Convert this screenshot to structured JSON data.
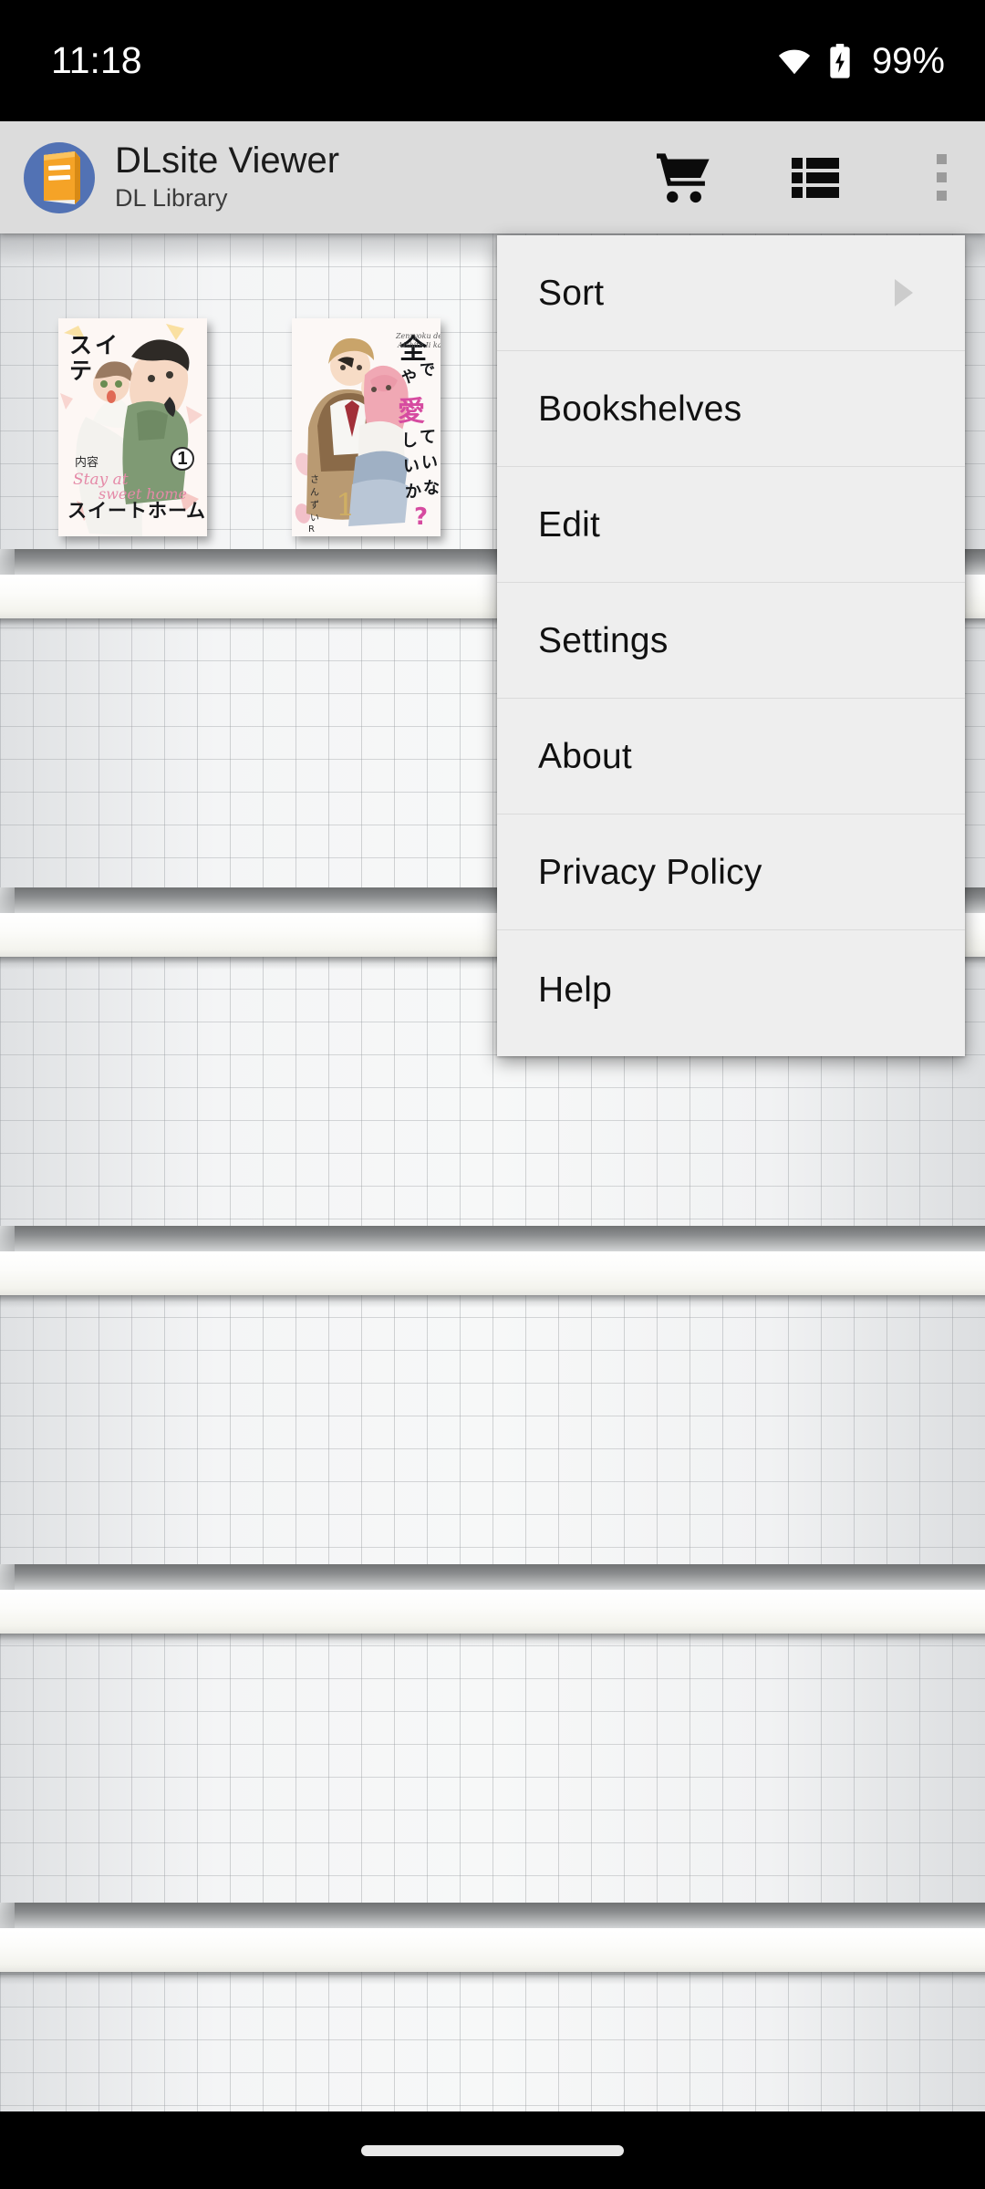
{
  "status_bar": {
    "clock": "11:18",
    "battery_percent": "99%",
    "icons": [
      "wifi-icon",
      "battery-charging-icon"
    ]
  },
  "app_bar": {
    "app_icon": "book-app-icon",
    "title": "DLsite Viewer",
    "subtitle": "DL Library",
    "actions": [
      {
        "name": "cart-icon",
        "label": "Cart"
      },
      {
        "name": "view-mode-icon",
        "label": "View mode"
      },
      {
        "name": "overflow-menu-icon",
        "label": "More options"
      }
    ]
  },
  "overflow_menu": {
    "items": [
      {
        "label": "Sort",
        "has_submenu": true
      },
      {
        "label": "Bookshelves",
        "has_submenu": false
      },
      {
        "label": "Edit",
        "has_submenu": false
      },
      {
        "label": "Settings",
        "has_submenu": false
      },
      {
        "label": "About",
        "has_submenu": false
      },
      {
        "label": "Privacy Policy",
        "has_submenu": false
      },
      {
        "label": "Help",
        "has_submenu": false
      }
    ]
  },
  "library": {
    "books": [
      {
        "title_lines": [
          "ステイ",
          "&",
          "スイートホーム"
        ],
        "romaji_title": "Stay at sweet home",
        "author": "内容",
        "volume_badge": "1"
      },
      {
        "title_lines": [
          "全力で",
          "愛して",
          "いいかな?"
        ],
        "author": "さんずい R",
        "volume_badge": "1"
      }
    ]
  },
  "nav_bar": {
    "gesture_pill": "home-gesture-pill"
  },
  "colors": {
    "status_bar_bg": "#000000",
    "app_bar_bg": "#dcdcdc",
    "menu_bg": "#eeeeee",
    "menu_divider": "#dadada",
    "accent_blue": "#5272b4",
    "accent_orange": "#f0a030",
    "nav_bar_bg": "#000000"
  }
}
